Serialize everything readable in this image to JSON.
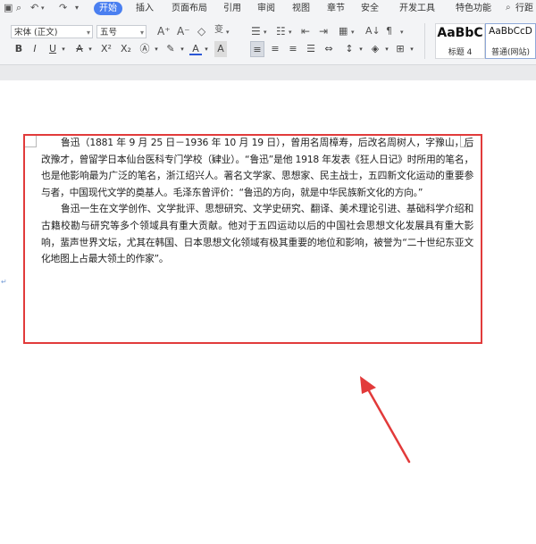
{
  "tabs": [
    "开始",
    "插入",
    "页面布局",
    "引用",
    "审阅",
    "视图",
    "章节",
    "安全",
    "开发工具",
    "特色功能",
    "行距"
  ],
  "font": {
    "name": "宋体 (正文)",
    "size": "五号"
  },
  "styles": [
    {
      "sample": "AaBbC",
      "label": "标题 4"
    },
    {
      "sample": "AaBbCcD",
      "label": "普通(网站)"
    }
  ],
  "document": {
    "paragraphs": [
      "鲁迅（1881 年 9 月 25 日－1936 年 10 月 19 日），曾用名周樟寿，后改名周树人，字豫山，后改豫才，曾留学日本仙台医科专门学校（肄业）。“鲁迅”是他 1918 年发表《狂人日记》时所用的笔名，也是他影响最为广泛的笔名，浙江绍兴人。著名文学家、思想家、民主战士，五四新文化运动的重要参与者，中国现代文学的奠基人。毛泽东曾评价：“鲁迅的方向，就是中华民族新文化的方向。”",
      "鲁迅一生在文学创作、文学批评、思想研究、文学史研究、翻译、美术理论引进、基础科学介绍和古籍校勘与研究等多个领域具有重大贡献。他对于五四运动以后的中国社会思想文化发展具有重大影响，蜚声世界文坛，尤其在韩国、日本思想文化领域有极其重要的地位和影响，被誉为“二十世纪东亚文化地图上占最大领土的作家”。"
    ]
  },
  "colors": {
    "accent": "#4a7ff0",
    "highlight_box": "#e13b3b"
  }
}
